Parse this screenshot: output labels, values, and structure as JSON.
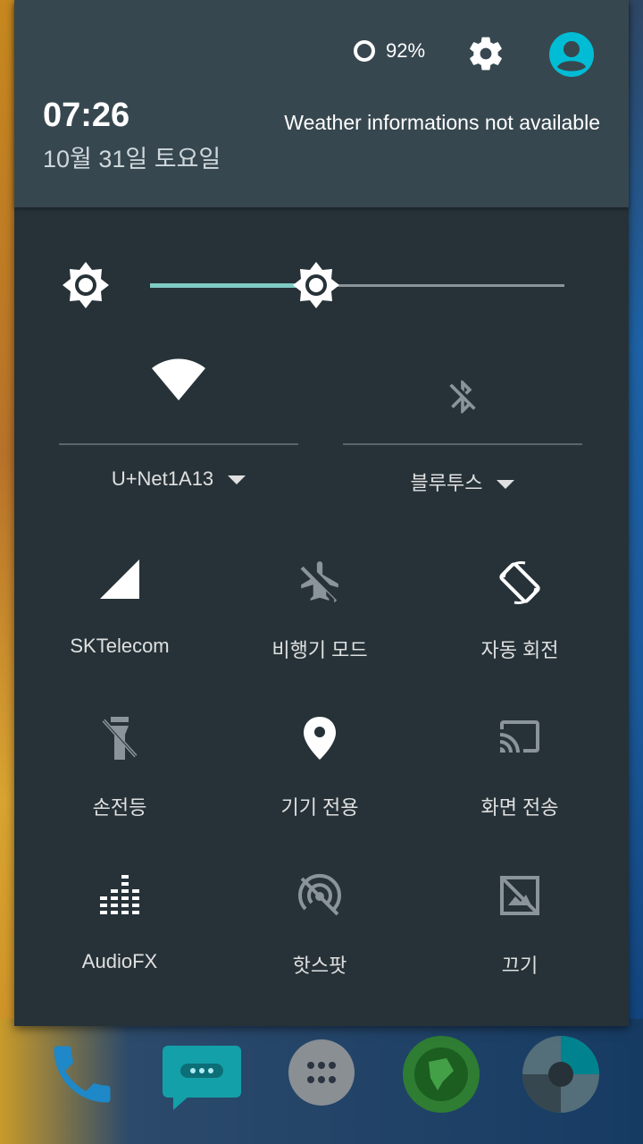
{
  "status": {
    "battery_percent": "92%",
    "settings_icon": "gear-icon",
    "user_icon": "account-circle-icon"
  },
  "header": {
    "time": "07:26",
    "date": "10월 31일 토요일",
    "weather": "Weather informations not available"
  },
  "brightness": {
    "level": 0.4,
    "icon": "brightness-icon"
  },
  "wifi": {
    "label": "U+Net1A13",
    "icon": "wifi-icon"
  },
  "bluetooth": {
    "label": "블루투스",
    "icon": "bluetooth-off-icon"
  },
  "tiles": [
    {
      "label": "SKTelecom",
      "icon": "cellular-signal-icon"
    },
    {
      "label": "비행기 모드",
      "icon": "airplane-off-icon"
    },
    {
      "label": "자동 회전",
      "icon": "auto-rotate-icon"
    },
    {
      "label": "손전등",
      "icon": "flashlight-off-icon"
    },
    {
      "label": "기기 전용",
      "icon": "location-icon"
    },
    {
      "label": "화면 전송",
      "icon": "cast-icon"
    },
    {
      "label": "AudioFX",
      "icon": "equalizer-icon"
    },
    {
      "label": "핫스팟",
      "icon": "hotspot-off-icon"
    },
    {
      "label": "끄기",
      "icon": "screen-off-icon"
    }
  ],
  "dock": [
    "phone-icon",
    "messaging-icon",
    "app-drawer-icon",
    "browser-icon",
    "camera-icon"
  ],
  "colors": {
    "accent": "#80cbc4",
    "panel": "#263238",
    "header": "#37474f"
  }
}
